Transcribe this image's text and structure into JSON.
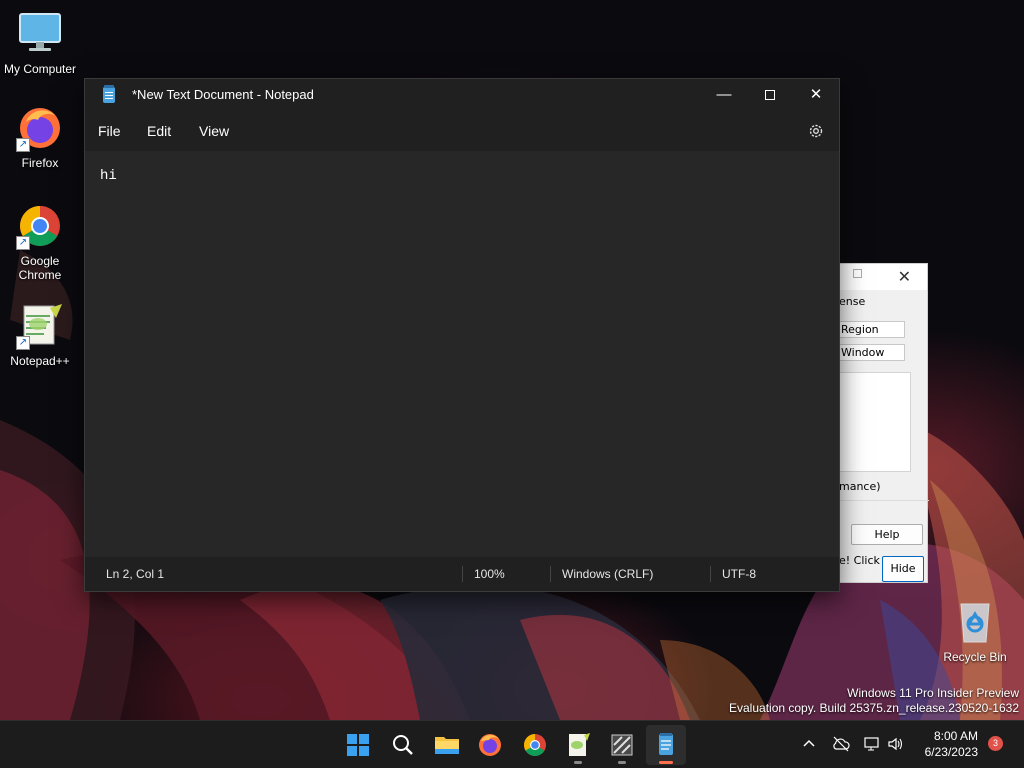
{
  "desktop": {
    "icons": [
      {
        "label": "My Computer"
      },
      {
        "label": "Firefox"
      },
      {
        "label": "Google Chrome"
      },
      {
        "label": "Notepad++"
      },
      {
        "label": "Recycle Bin"
      }
    ],
    "watermark": {
      "line1": "Windows 11 Pro Insider Preview",
      "line2": "Evaluation copy. Build 25375.zn_release.230520-1632"
    }
  },
  "notepad": {
    "title": "*New Text Document - Notepad",
    "icon": "notepad-icon",
    "menu": [
      "File",
      "Edit",
      "View"
    ],
    "settings_icon": "gear-icon",
    "content": "hi",
    "status": {
      "position": "Ln 2, Col 1",
      "zoom": "100%",
      "line_ending": "Windows (CRLF)",
      "encoding": "UTF-8"
    }
  },
  "background_dialog": {
    "text1": "ense",
    "field1": "Region",
    "field2": "Window",
    "text2": "mance)",
    "help_button": "Help",
    "text3": "e! Click",
    "hide_button": "Hide"
  },
  "taskbar": {
    "items": [
      "start-icon",
      "search-icon",
      "file-explorer-icon",
      "firefox-icon",
      "chrome-icon",
      "notepadpp-icon",
      "app-icon",
      "notepad-icon"
    ],
    "clock_time": "8:00 AM",
    "clock_date": "6/23/2023",
    "notification_count": "3"
  },
  "colors": {
    "window_bg": "#202020",
    "editor_bg": "#272727",
    "taskbar_bg": "#1c1c1c",
    "accent": "#ff6f4e"
  }
}
